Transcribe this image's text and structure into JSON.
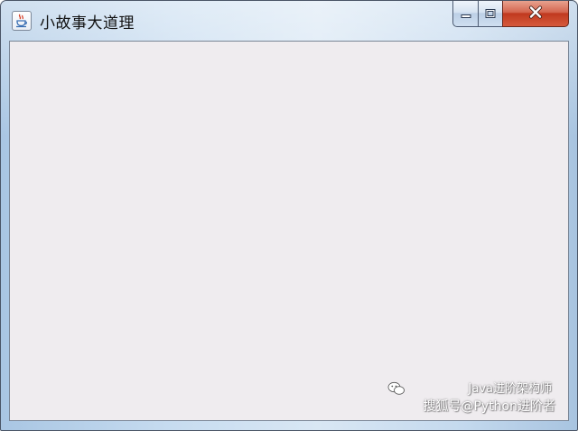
{
  "window": {
    "title": "小故事大道理",
    "icon": "java-coffee-cup-icon",
    "buttons": {
      "minimize_icon": "minimize-icon",
      "maximize_icon": "maximize-icon",
      "close_icon": "close-icon"
    }
  },
  "watermark": {
    "line1": "Java进阶架构师",
    "line2": "搜狐号@Python进阶者",
    "logo_icon": "wechat-icon"
  },
  "colors": {
    "client_background": "#efecef",
    "close_button": "#c7452a",
    "frame": "#c7dcf0"
  }
}
